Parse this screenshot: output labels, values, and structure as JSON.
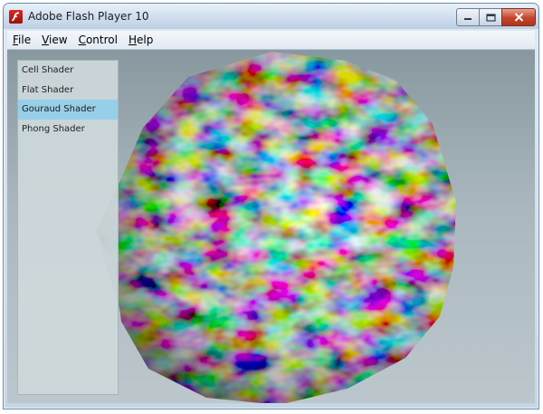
{
  "window": {
    "title": "Adobe Flash Player 10",
    "controls": [
      "minimize",
      "maximize",
      "close"
    ]
  },
  "menu": {
    "items": [
      {
        "label": "File",
        "accel": "F",
        "rest": "ile"
      },
      {
        "label": "View",
        "accel": "V",
        "rest": "iew"
      },
      {
        "label": "Control",
        "accel": "C",
        "rest": "ontrol"
      },
      {
        "label": "Help",
        "accel": "H",
        "rest": "elp"
      }
    ]
  },
  "shader_list": {
    "items": [
      {
        "label": "Cell Shader"
      },
      {
        "label": "Flat Shader"
      },
      {
        "label": "Gouraud Shader"
      },
      {
        "label": "Phong Shader"
      }
    ],
    "selected_index": 2,
    "selected_color": "#98cfe8"
  },
  "stage": {
    "background_color": "#a9b6bc",
    "object": "texture-mapped polygonal sphere with multicolored texture"
  },
  "colors": {
    "close_button": "#c3452d",
    "app_icon": "#c8241a"
  }
}
